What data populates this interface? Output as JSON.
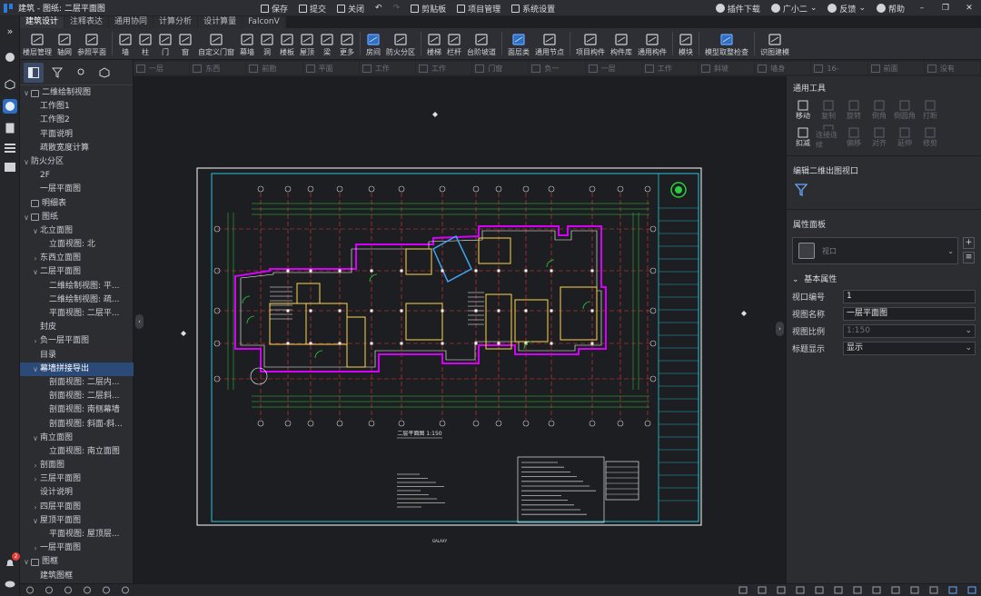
{
  "title": "建筑 - 图纸: 二层平面图",
  "quick_actions": [
    {
      "label": "保存",
      "icon": "save-icon"
    },
    {
      "label": "提交",
      "icon": "submit-icon"
    },
    {
      "label": "关闭",
      "icon": "close-doc-icon"
    },
    {
      "label": "剪贴板",
      "icon": "clipboard-icon"
    },
    {
      "label": "项目管理",
      "icon": "project-icon"
    },
    {
      "label": "系统设置",
      "icon": "gear-icon"
    }
  ],
  "top_right": {
    "plugin": "插件下载",
    "user": "广小二",
    "feedback": "反馈",
    "help": "帮助"
  },
  "ribbon_tabs": [
    "建筑设计",
    "注释表达",
    "通用协同",
    "计算分析",
    "设计算量",
    "FalconV"
  ],
  "ribbon_buttons": [
    {
      "label": "楼层管理"
    },
    {
      "label": "轴网"
    },
    {
      "label": "参照平面"
    },
    {
      "sep": true
    },
    {
      "label": "墙"
    },
    {
      "label": "柱"
    },
    {
      "label": "门"
    },
    {
      "label": "窗"
    },
    {
      "label": "自定义门窗"
    },
    {
      "label": "幕墙"
    },
    {
      "label": "洞"
    },
    {
      "label": "楼板"
    },
    {
      "label": "屋顶"
    },
    {
      "label": "梁"
    },
    {
      "label": "更多"
    },
    {
      "sep": true
    },
    {
      "label": "房间"
    },
    {
      "label": "防火分区"
    },
    {
      "sep": true
    },
    {
      "label": "楼梯"
    },
    {
      "label": "栏杆"
    },
    {
      "label": "台阶坡道"
    },
    {
      "sep": true
    },
    {
      "label": "面层类"
    },
    {
      "label": "通用节点"
    },
    {
      "sep": true
    },
    {
      "label": "项目构件"
    },
    {
      "label": "构件库"
    },
    {
      "label": "通用构件"
    },
    {
      "sep": true
    },
    {
      "label": "模块"
    },
    {
      "sep": true
    },
    {
      "label": "模型取整检查"
    },
    {
      "sep": true
    },
    {
      "label": "识图建模"
    }
  ],
  "view_tiles": [
    "一层",
    "东西",
    "前勘",
    "平面",
    "工作",
    "工作",
    "门窗",
    "负一",
    "一层",
    "工作",
    "斜坡",
    "墙身",
    "16-",
    "前面",
    "没有"
  ],
  "tree": [
    {
      "d": 0,
      "c": "v",
      "t": "二维绘制视图",
      "i": true
    },
    {
      "d": 1,
      "t": "工作图1"
    },
    {
      "d": 1,
      "t": "工作图2"
    },
    {
      "d": 1,
      "t": "平面说明"
    },
    {
      "d": 1,
      "t": "疏散宽度计算"
    },
    {
      "d": 0,
      "c": "v",
      "t": "防火分区"
    },
    {
      "d": 1,
      "t": "2F"
    },
    {
      "d": 1,
      "t": "一层平面图"
    },
    {
      "d": 0,
      "c": "",
      "t": "明细表",
      "i": true
    },
    {
      "d": 0,
      "c": "v",
      "t": "图纸",
      "i": true
    },
    {
      "d": 1,
      "c": "v",
      "t": "北立面图"
    },
    {
      "d": 2,
      "t": "立面视图: 北"
    },
    {
      "d": 1,
      "c": ">",
      "t": "东西立面图"
    },
    {
      "d": 1,
      "c": "v",
      "t": "二层平面图"
    },
    {
      "d": 2,
      "t": "二维绘制视图: 平..."
    },
    {
      "d": 2,
      "t": "二维绘制视图: 疏..."
    },
    {
      "d": 2,
      "t": "平面视图: 二层平..."
    },
    {
      "d": 1,
      "t": "封皮"
    },
    {
      "d": 1,
      "c": ">",
      "t": "负一层平面图"
    },
    {
      "d": 1,
      "t": "目录"
    },
    {
      "d": 1,
      "c": "v",
      "t": "幕墙拼接导出",
      "sel": true
    },
    {
      "d": 2,
      "t": "剖面视图: 二层内..."
    },
    {
      "d": 2,
      "t": "剖面视图: 二层斜..."
    },
    {
      "d": 2,
      "t": "剖面视图: 南侧幕墙"
    },
    {
      "d": 2,
      "t": "剖面视图: 斜面-斜..."
    },
    {
      "d": 1,
      "c": "v",
      "t": "南立面图"
    },
    {
      "d": 2,
      "t": "立面视图: 南立面图"
    },
    {
      "d": 1,
      "c": ">",
      "t": "剖面图"
    },
    {
      "d": 1,
      "c": ">",
      "t": "三层平面图"
    },
    {
      "d": 1,
      "t": "设计说明"
    },
    {
      "d": 1,
      "c": ">",
      "t": "四层平面图"
    },
    {
      "d": 1,
      "c": "v",
      "t": "屋顶平面图"
    },
    {
      "d": 2,
      "t": "平面视图: 屋顶层..."
    },
    {
      "d": 1,
      "c": ">",
      "t": "一层平面图"
    },
    {
      "d": 0,
      "c": "v",
      "t": "图框",
      "i": true
    },
    {
      "d": 1,
      "t": "建筑图框"
    }
  ],
  "general_tools": {
    "title": "通用工具",
    "items": [
      [
        "移动",
        true
      ],
      [
        "复制",
        false
      ],
      [
        "旋转",
        false
      ],
      [
        "倒角",
        false
      ],
      [
        "倒圆角",
        false
      ],
      [
        "打断",
        false
      ],
      [
        "",
        false
      ],
      [
        "扣减",
        true
      ],
      [
        "连接连续",
        false
      ],
      [
        "偏移",
        false
      ],
      [
        "对齐",
        false
      ],
      [
        "延伸",
        false
      ],
      [
        "修剪",
        false
      ],
      [
        "",
        false
      ]
    ]
  },
  "viewport_section": {
    "title": "编辑二维出图视口"
  },
  "properties": {
    "title": "属性面板",
    "type": "视口",
    "basic": "基本属性",
    "rows": [
      {
        "k": "视口编号",
        "v": "1"
      },
      {
        "k": "视图名称",
        "v": "一层平面图"
      },
      {
        "k": "视图比例",
        "v": "1:150",
        "dim": true,
        "dd": true
      },
      {
        "k": "标题显示",
        "v": "显示",
        "dd": true
      }
    ]
  },
  "drawing": {
    "caption": "二层平面图 1:150",
    "bottom": "GALAXY"
  },
  "notification_badge": "2",
  "colors": {
    "bg": "#1e1f22",
    "panel": "#2b2d31",
    "accent": "#2c4a78",
    "cad_frame": "#26c6da",
    "cad_wall": "#ffd54f",
    "cad_axis": "#e53935",
    "cad_purple": "#d500f9",
    "cad_green": "#2ecc40"
  }
}
